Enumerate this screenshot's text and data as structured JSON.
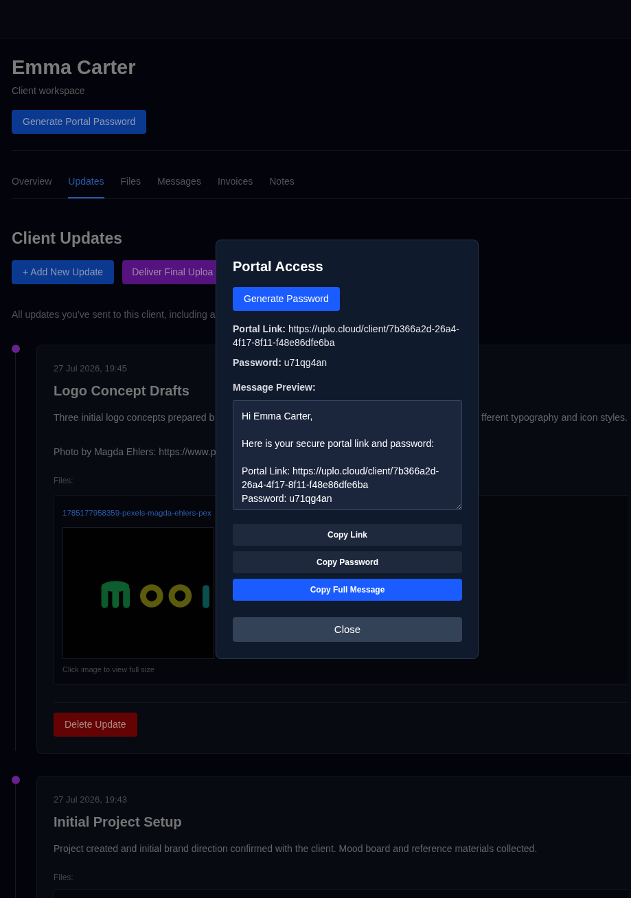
{
  "header": {
    "name": "Emma Carter",
    "subtitle": "Client workspace",
    "button": "Generate Portal Password"
  },
  "tabs": [
    {
      "label": "Overview",
      "selected": false
    },
    {
      "label": "Updates",
      "selected": true
    },
    {
      "label": "Files",
      "selected": false
    },
    {
      "label": "Messages",
      "selected": false
    },
    {
      "label": "Invoices",
      "selected": false
    },
    {
      "label": "Notes",
      "selected": false
    }
  ],
  "section": {
    "title": "Client Updates",
    "buttons": [
      {
        "label": "+ Add New Update",
        "kind": "primary"
      },
      {
        "label": "Deliver Final Uploa",
        "kind": "deliver"
      }
    ],
    "intro": "All updates you’ve sent to this client, including a"
  },
  "updates": [
    {
      "date": "27 Jul 2026, 19:45",
      "title": "Logo Concept Drafts",
      "description": [
        "Three initial logo concepts prepared b",
        "fferent typography and icon styles."
      ],
      "credit": "Photo by Magda Ehlers: https://www.p",
      "files_label": "Files:",
      "files": [
        {
          "name": "1785177958359-pexels-magda-ehlers-pex",
          "caption": "Click image to view full size",
          "kind": "picture"
        }
      ],
      "delete_button": "Delete Update"
    },
    {
      "date": "27 Jul 2026, 19:43",
      "title": "Initial Project Setup",
      "description": [
        "Project created and initial brand direction confirmed with the client. Mood board and reference materials collected."
      ],
      "files_label": "Files:"
    }
  ],
  "modal": {
    "title": "Portal Access",
    "generate_button": "Generate Password",
    "fields": [
      "**Portal Link:** https://uplo.cloud/client/7b366a2d-26a4-4f17-8f11-f48e86dfe6ba",
      "**Password:** u71qg4an"
    ],
    "preview_label": "Message Preview:",
    "preview_text": "Hi Emma Carter,\n\nHere is your secure portal link and password:\n\nPortal Link: https://uplo.cloud/client/7b366a2d-26a4-4f17-8f11-f48e86dfe6ba\nPassword: u71qg4an",
    "copy_buttons": [
      {
        "label": "Copy Link",
        "primary": false
      },
      {
        "label": "Copy Password",
        "primary": false
      },
      {
        "label": "Copy Full Message",
        "primary": true
      }
    ],
    "close_button": "Close"
  }
}
